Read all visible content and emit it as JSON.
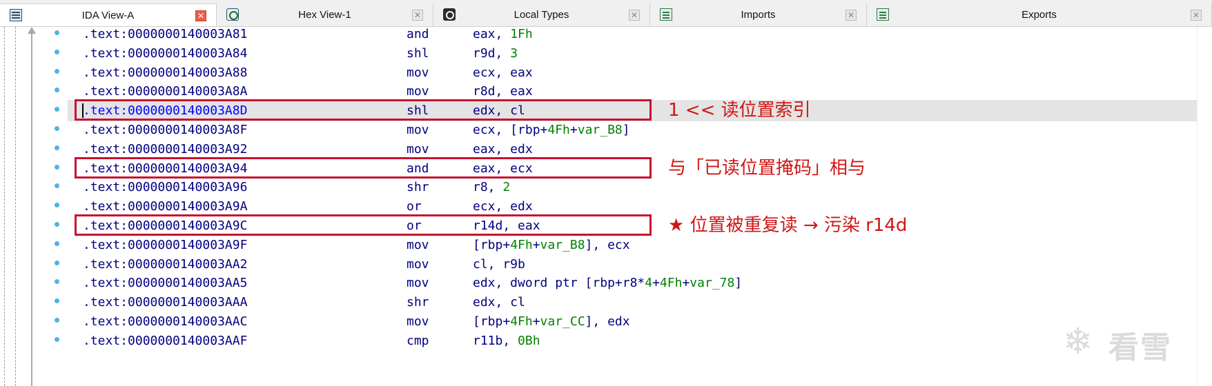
{
  "tabs": [
    {
      "label": "IDA View-A",
      "icon": "ida-view-icon",
      "active": true
    },
    {
      "label": "Hex View-1",
      "icon": "hex-view-icon",
      "active": false
    },
    {
      "label": "Local Types",
      "icon": "local-types-icon",
      "active": false
    },
    {
      "label": "Imports",
      "icon": "imports-icon",
      "active": false
    },
    {
      "label": "Exports",
      "icon": "exports-icon",
      "active": false
    }
  ],
  "tab_close_glyph": "✕",
  "code_lines": [
    {
      "addr": ".text:0000000140003A81",
      "mnemonic": "and",
      "operands": [
        {
          "t": "eax, "
        },
        {
          "t": "1Fh",
          "n": true
        }
      ]
    },
    {
      "addr": ".text:0000000140003A84",
      "mnemonic": "shl",
      "operands": [
        {
          "t": "r9d, "
        },
        {
          "t": "3",
          "n": true
        }
      ]
    },
    {
      "addr": ".text:0000000140003A88",
      "mnemonic": "mov",
      "operands": [
        {
          "t": "ecx, eax"
        }
      ]
    },
    {
      "addr": ".text:0000000140003A8A",
      "mnemonic": "mov",
      "operands": [
        {
          "t": "r8d, eax"
        }
      ]
    },
    {
      "addr": ".text:0000000140003A8D",
      "mnemonic": "shl",
      "operands": [
        {
          "t": "edx, cl"
        }
      ],
      "current": true
    },
    {
      "addr": ".text:0000000140003A8F",
      "mnemonic": "mov",
      "operands": [
        {
          "t": "ecx, [rbp+"
        },
        {
          "t": "4Fh",
          "n": true
        },
        {
          "t": "+"
        },
        {
          "t": "var_B8",
          "n": true
        },
        {
          "t": "]"
        }
      ]
    },
    {
      "addr": ".text:0000000140003A92",
      "mnemonic": "mov",
      "operands": [
        {
          "t": "eax, edx"
        }
      ]
    },
    {
      "addr": ".text:0000000140003A94",
      "mnemonic": "and",
      "operands": [
        {
          "t": "eax, ecx"
        }
      ]
    },
    {
      "addr": ".text:0000000140003A96",
      "mnemonic": "shr",
      "operands": [
        {
          "t": "r8, "
        },
        {
          "t": "2",
          "n": true
        }
      ]
    },
    {
      "addr": ".text:0000000140003A9A",
      "mnemonic": "or",
      "operands": [
        {
          "t": "ecx, edx"
        }
      ]
    },
    {
      "addr": ".text:0000000140003A9C",
      "mnemonic": "or",
      "operands": [
        {
          "t": "r14d, eax"
        }
      ]
    },
    {
      "addr": ".text:0000000140003A9F",
      "mnemonic": "mov",
      "operands": [
        {
          "t": "[rbp+"
        },
        {
          "t": "4Fh",
          "n": true
        },
        {
          "t": "+"
        },
        {
          "t": "var_B8",
          "n": true
        },
        {
          "t": "], ecx"
        }
      ]
    },
    {
      "addr": ".text:0000000140003AA2",
      "mnemonic": "mov",
      "operands": [
        {
          "t": "cl, r9b"
        }
      ]
    },
    {
      "addr": ".text:0000000140003AA5",
      "mnemonic": "mov",
      "operands": [
        {
          "t": "edx, dword ptr [rbp+r8*"
        },
        {
          "t": "4",
          "n": true
        },
        {
          "t": "+"
        },
        {
          "t": "4Fh",
          "n": true
        },
        {
          "t": "+"
        },
        {
          "t": "var_78",
          "n": true
        },
        {
          "t": "]"
        }
      ]
    },
    {
      "addr": ".text:0000000140003AAA",
      "mnemonic": "shr",
      "operands": [
        {
          "t": "edx, cl"
        }
      ]
    },
    {
      "addr": ".text:0000000140003AAC",
      "mnemonic": "mov",
      "operands": [
        {
          "t": "[rbp+"
        },
        {
          "t": "4Fh",
          "n": true
        },
        {
          "t": "+"
        },
        {
          "t": "var_CC",
          "n": true
        },
        {
          "t": "], edx"
        }
      ]
    },
    {
      "addr": ".text:0000000140003AAF",
      "mnemonic": "cmp",
      "operands": [
        {
          "t": "r11b, "
        },
        {
          "t": "0Bh",
          "n": true
        }
      ]
    }
  ],
  "annotations": [
    {
      "line_index": 4,
      "text": "1 << 读位置索引"
    },
    {
      "line_index": 7,
      "text": "与「已读位置掩码」相与"
    },
    {
      "line_index": 10,
      "text": "★ 位置被重复读 → 污染 r14d"
    }
  ],
  "watermark": {
    "text": "看雪",
    "icon": "snowflake-logo-icon"
  },
  "colors": {
    "address": "#000080",
    "current_address": "#0000ff",
    "number": "#008000",
    "annotation": "#d01616",
    "box_border": "#c8102e",
    "gutter_dot": "#4fb3e6",
    "highlight_row": "#e4e4e4"
  }
}
